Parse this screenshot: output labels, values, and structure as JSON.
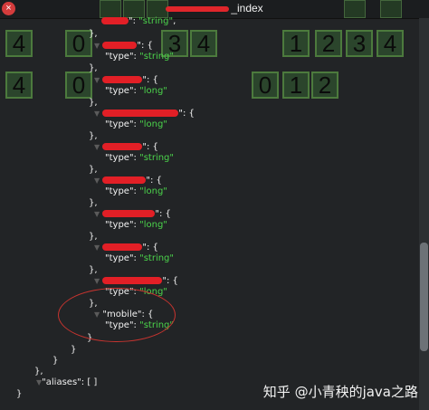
{
  "window": {
    "title_suffix": "_index",
    "close_icon": "close-icon"
  },
  "tiles": {
    "row1": [
      "4",
      "0",
      "3",
      "4",
      "1",
      "2",
      "3",
      "4"
    ],
    "row2": [
      "4",
      "0",
      "0",
      "1",
      "2"
    ]
  },
  "json_view": {
    "fields": [
      {
        "type": "string"
      },
      {
        "type": "string"
      },
      {
        "type": "long"
      },
      {
        "type": "long"
      },
      {
        "type": "string"
      },
      {
        "type": "long"
      },
      {
        "type": "long"
      },
      {
        "type": "string"
      },
      {
        "type": "long"
      }
    ],
    "mobile": {
      "key": "mobile",
      "type": "string"
    },
    "aliases_key": "aliases",
    "aliases_value": "[ ]"
  },
  "watermark": "知乎 @小青秧的java之路",
  "colors": {
    "background": "#222426",
    "string_value": "#4bd34b",
    "redaction": "#e21f26",
    "annotation_circle": "#c7342f",
    "tile_border": "#4c7a3d"
  }
}
